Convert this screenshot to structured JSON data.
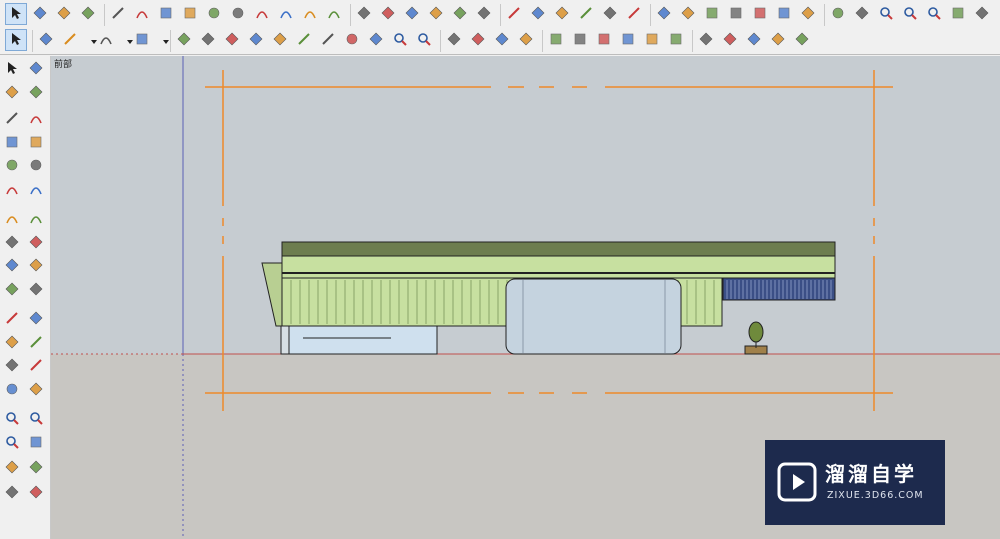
{
  "viewport": {
    "view_name": "前部",
    "colors": {
      "sky": "#c6ccd1",
      "ground": "#c8c6c2",
      "red_axis": "#c0504d",
      "blue_axis": "#5b5fb5",
      "guides": "#ee8a2a",
      "roof": "#6d7d4f",
      "facade": "#c7e0a0",
      "glass": "#cfe0ee",
      "drum": "#c5d3df",
      "louver": "#3b4f86"
    }
  },
  "toolbars": {
    "row1_tools": [
      "select-arrow-icon",
      "component-icon",
      "paint-bucket-icon",
      "eraser-icon",
      "pencil-icon",
      "freehand-icon",
      "rectangle-icon",
      "rotated-rectangle-icon",
      "circle-icon",
      "polygon-icon",
      "arc-icon",
      "two-point-arc-icon",
      "three-point-arc-icon",
      "pie-icon",
      "move-icon",
      "push-pull-icon",
      "rotate-icon",
      "follow-me-icon",
      "scale-icon",
      "offset-icon",
      "tape-measure-icon",
      "dimension-icon",
      "protractor-icon",
      "text-icon",
      "axes-icon",
      "3d-text-icon",
      "xray-icon",
      "back-edges-icon",
      "wireframe-icon",
      "hidden-line-icon",
      "shaded-icon",
      "shaded-textures-icon",
      "monochrome-icon",
      "orbit-icon",
      "pan-icon",
      "zoom-icon",
      "zoom-window-icon",
      "zoom-extents-icon",
      "previous-view-icon",
      "position-camera-icon"
    ],
    "row2_tools": [
      "select-arrow-icon",
      "eraser-icon",
      "pencil-icon",
      "dropdown-arrow-icon",
      "arc-icon",
      "dropdown-arrow-icon",
      "rectangle-icon",
      "dropdown-arrow-icon",
      "push-pull-icon",
      "offset-icon",
      "move-icon",
      "rotate-icon",
      "scale-icon",
      "tape-measure-icon",
      "text-icon",
      "orbit-icon",
      "pan-icon",
      "zoom-icon",
      "zoom-extents-icon",
      "warehouse-icon",
      "extension-icon",
      "send-icon",
      "ruby-icon",
      "iso-view-icon",
      "top-view-icon",
      "front-view-icon",
      "right-view-icon",
      "back-view-icon",
      "left-view-icon",
      "union-icon",
      "intersect-icon",
      "subtract-icon",
      "trim-icon",
      "split-icon"
    ],
    "left_tools": [
      "select-arrow-icon",
      "component-icon",
      "paint-bucket-icon",
      "eraser-icon",
      "pencil-icon",
      "freehand-icon",
      "rectangle-icon",
      "rotated-rectangle-icon",
      "circle-icon",
      "polygon-icon",
      "arc-icon",
      "two-point-arc-icon",
      "three-point-arc-icon",
      "pie-icon",
      "move-icon",
      "push-pull-icon",
      "rotate-icon",
      "follow-me-icon",
      "scale-icon",
      "offset-icon",
      "tape-measure-icon",
      "dimension-icon",
      "protractor-icon",
      "text-icon",
      "axes-icon",
      "3d-text-icon",
      "orbit-icon",
      "pan-icon",
      "zoom-icon",
      "zoom-window-icon",
      "zoom-extents-icon",
      "previous-view-icon",
      "position-camera-icon",
      "look-around-icon",
      "walk-icon",
      "section-plane-icon"
    ]
  },
  "watermark": {
    "title": "溜溜自学",
    "url": "ZIXUE.3D66.COM"
  }
}
